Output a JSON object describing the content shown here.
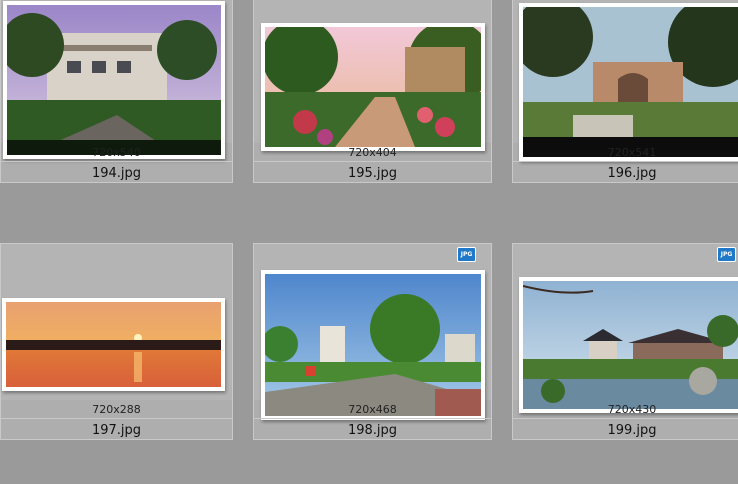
{
  "badge_label": "JPG",
  "items": [
    {
      "name": "194.jpg",
      "dims": "720x540"
    },
    {
      "name": "195.jpg",
      "dims": "720x404"
    },
    {
      "name": "196.jpg",
      "dims": "720x541"
    },
    {
      "name": "197.jpg",
      "dims": "720x288"
    },
    {
      "name": "198.jpg",
      "dims": "720x468"
    },
    {
      "name": "199.jpg",
      "dims": "720x430"
    }
  ]
}
